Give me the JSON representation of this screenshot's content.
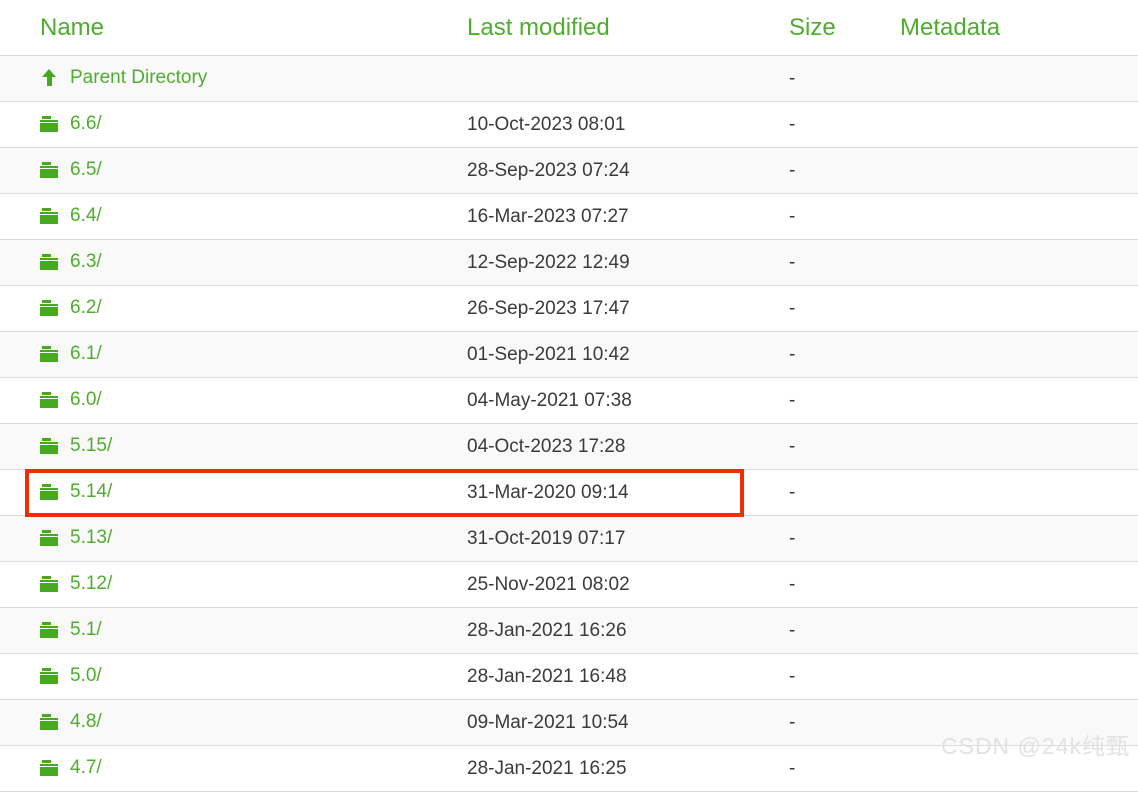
{
  "page": {
    "title": "Index of directory listing",
    "accent_color": "#4fad2e",
    "highlight_color": "#f42c00",
    "row_alt_color": "#f9f9f9"
  },
  "table": {
    "headers": {
      "name": "Name",
      "last_modified": "Last modified",
      "size": "Size",
      "metadata": "Metadata"
    },
    "rows": [
      {
        "icon": "up-arrow-icon",
        "name": "Parent Directory",
        "last_modified": "",
        "size": "-",
        "metadata": ""
      },
      {
        "icon": "folder-icon",
        "name": "6.6/",
        "last_modified": "10-Oct-2023 08:01",
        "size": "-",
        "metadata": ""
      },
      {
        "icon": "folder-icon",
        "name": "6.5/",
        "last_modified": "28-Sep-2023 07:24",
        "size": "-",
        "metadata": ""
      },
      {
        "icon": "folder-icon",
        "name": "6.4/",
        "last_modified": "16-Mar-2023 07:27",
        "size": "-",
        "metadata": ""
      },
      {
        "icon": "folder-icon",
        "name": "6.3/",
        "last_modified": "12-Sep-2022 12:49",
        "size": "-",
        "metadata": ""
      },
      {
        "icon": "folder-icon",
        "name": "6.2/",
        "last_modified": "26-Sep-2023 17:47",
        "size": "-",
        "metadata": ""
      },
      {
        "icon": "folder-icon",
        "name": "6.1/",
        "last_modified": "01-Sep-2021 10:42",
        "size": "-",
        "metadata": ""
      },
      {
        "icon": "folder-icon",
        "name": "6.0/",
        "last_modified": "04-May-2021 07:38",
        "size": "-",
        "metadata": ""
      },
      {
        "icon": "folder-icon",
        "name": "5.15/",
        "last_modified": "04-Oct-2023 17:28",
        "size": "-",
        "metadata": ""
      },
      {
        "icon": "folder-icon",
        "name": "5.14/",
        "last_modified": "31-Mar-2020 09:14",
        "size": "-",
        "metadata": ""
      },
      {
        "icon": "folder-icon",
        "name": "5.13/",
        "last_modified": "31-Oct-2019 07:17",
        "size": "-",
        "metadata": ""
      },
      {
        "icon": "folder-icon",
        "name": "5.12/",
        "last_modified": "25-Nov-2021 08:02",
        "size": "-",
        "metadata": ""
      },
      {
        "icon": "folder-icon",
        "name": "5.1/",
        "last_modified": "28-Jan-2021 16:26",
        "size": "-",
        "metadata": ""
      },
      {
        "icon": "folder-icon",
        "name": "5.0/",
        "last_modified": "28-Jan-2021 16:48",
        "size": "-",
        "metadata": ""
      },
      {
        "icon": "folder-icon",
        "name": "4.8/",
        "last_modified": "09-Mar-2021 10:54",
        "size": "-",
        "metadata": ""
      },
      {
        "icon": "folder-icon",
        "name": "4.7/",
        "last_modified": "28-Jan-2021 16:25",
        "size": "-",
        "metadata": ""
      }
    ],
    "highlighted_row_name": "5.14/"
  },
  "watermark": {
    "text": "CSDN @24k纯甄"
  }
}
